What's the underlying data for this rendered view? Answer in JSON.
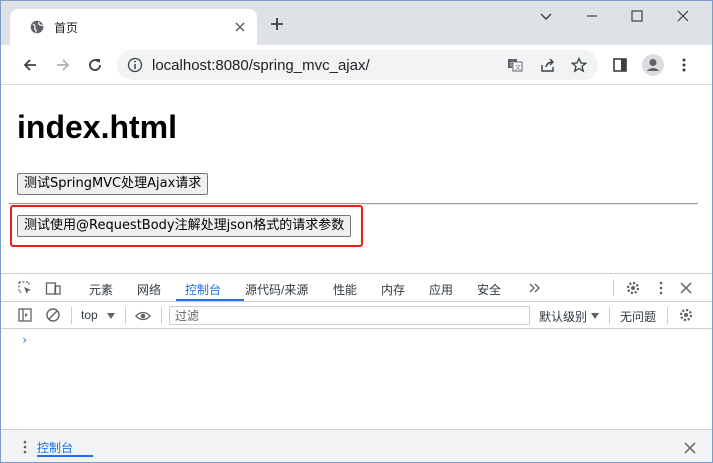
{
  "browser": {
    "tab_title": "首页",
    "url": "localhost:8080/spring_mvc_ajax/"
  },
  "page": {
    "heading": "index.html",
    "button1_label": "测试SpringMVC处理Ajax请求",
    "button2_label": "测试使用@RequestBody注解处理json格式的请求参数"
  },
  "devtools": {
    "tabs": [
      "元素",
      "网络",
      "控制台",
      "源代码/来源",
      "性能",
      "内存",
      "应用",
      "安全"
    ],
    "active_tab": "控制台",
    "context": "top",
    "filter_placeholder": "过滤",
    "log_level": "默认级别",
    "issues": "无问题",
    "drawer_tab": "控制台"
  },
  "colors": {
    "accent": "#1a73e8",
    "highlight": "#e8211d"
  }
}
